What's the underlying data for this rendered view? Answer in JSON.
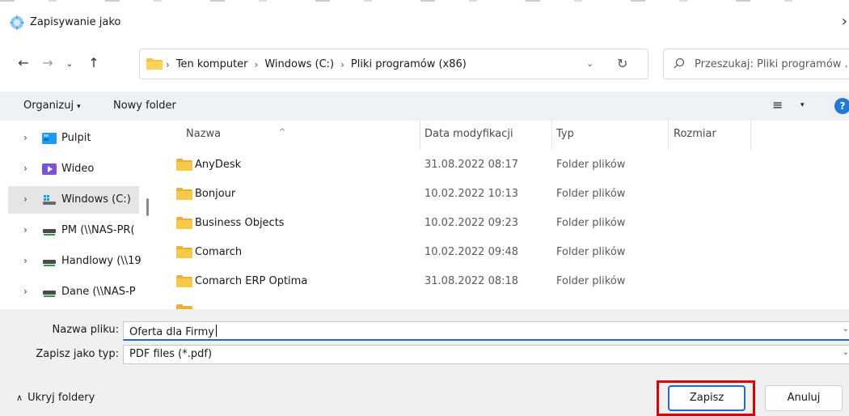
{
  "window": {
    "title": "Zapisywanie jako",
    "close_glyph": "›"
  },
  "nav": {
    "back": "←",
    "forward": "→",
    "recent": "⌄",
    "up": "↑",
    "breadcrumbs": [
      "Ten komputer",
      "Windows (C:)",
      "Pliki programów (x86)"
    ],
    "separator": "›",
    "dropdown": "⌄",
    "refresh": "↻",
    "search_placeholder": "Przeszukaj: Pliki programów ..."
  },
  "toolbar": {
    "organize": "Organizuj",
    "organize_caret": "▾",
    "new_folder": "Nowy folder",
    "view_glyph": "≡",
    "view_caret": "▾",
    "help": "?"
  },
  "sidebar": {
    "items": [
      {
        "label": "Pulpit",
        "icon": "desktop-icon",
        "selected": false
      },
      {
        "label": "Wideo",
        "icon": "video-icon",
        "selected": false
      },
      {
        "label": "Windows (C:)",
        "icon": "drive-icon",
        "selected": true
      },
      {
        "label": "PM (\\\\NAS-PR(",
        "icon": "network-drive-icon",
        "selected": false
      },
      {
        "label": "Handlowy (\\\\19",
        "icon": "network-drive-icon",
        "selected": false
      },
      {
        "label": "Dane (\\\\NAS-P",
        "icon": "network-drive-icon",
        "selected": false
      }
    ],
    "chevron": "›"
  },
  "filelist": {
    "columns": {
      "name": "Nazwa",
      "date": "Data modyfikacji",
      "type": "Typ",
      "size": "Rozmiar"
    },
    "sort_glyph": "^",
    "rows": [
      {
        "name": "AnyDesk",
        "date": "31.08.2022 08:17",
        "type": "Folder plików"
      },
      {
        "name": "Bonjour",
        "date": "10.02.2022 10:13",
        "type": "Folder plików"
      },
      {
        "name": "Business Objects",
        "date": "10.02.2022 09:23",
        "type": "Folder plików"
      },
      {
        "name": "Comarch",
        "date": "10.02.2022 09:48",
        "type": "Folder plików"
      },
      {
        "name": "Comarch ERP Optima",
        "date": "31.08.2022 08:18",
        "type": "Folder plików"
      }
    ]
  },
  "form": {
    "filename_label": "Nazwa pliku:",
    "filename_value": "Oferta dla Firmy",
    "filetype_label": "Zapisz jako typ:",
    "filetype_value": "PDF files (*.pdf)",
    "dropdown": "⌄"
  },
  "footer": {
    "hide_folders": "Ukryj foldery",
    "hide_chevron": "∧",
    "save": "Zapisz",
    "cancel": "Anuluj"
  },
  "colors": {
    "accent": "#1e6ac8",
    "highlight": "#e00000",
    "folder": "#f5c242"
  }
}
